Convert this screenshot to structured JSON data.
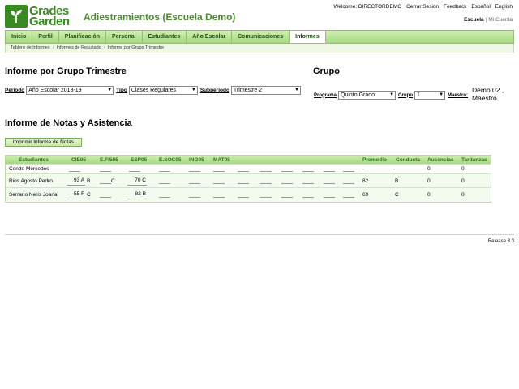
{
  "app": {
    "logo_line1": "Grades",
    "logo_line2": "Garden",
    "title": "Adiestramientos (Escuela Demo)"
  },
  "top_links": {
    "welcome": "Welcome: DIRECTORDEMO",
    "logout": "Cerrar Sesión",
    "feedback": "Feedback",
    "lang_es": "Español",
    "lang_en": "English",
    "school": "Escuela",
    "separator": "|",
    "account": "Mi Cuenta"
  },
  "nav": {
    "items": [
      "Inicio",
      "Perfil",
      "Planificación",
      "Personal",
      "Estudiantes",
      "Año Escolar",
      "Comunicaciones",
      "Informes"
    ],
    "active": "Informes"
  },
  "breadcrumb": {
    "items": [
      "Tablero de Informes",
      "Informes de Resultado",
      "Informe por Grupo Trimestre"
    ],
    "arrow": "›"
  },
  "headings": {
    "left": "Informe por Grupo Trimestre",
    "right": "Grupo",
    "report": "Informe de Notas y Asistencia"
  },
  "filters": {
    "periodo_label": "Periodo",
    "periodo_value": "Año Escolar 2018-19",
    "tipo_label": "Tipo",
    "tipo_value": "Clases Regulares",
    "subperiodo_label": "Subperiodo",
    "subperiodo_value": "Trimestre 2",
    "programa_label": "Programa",
    "programa_value": "Quinto Grado",
    "grupo_label": "Grupo",
    "grupo_value": "1",
    "maestro_label": "Maestro:",
    "maestro_value": "Demo 02 , Maestro"
  },
  "print_button": "Imprimir Informe de Notas",
  "grid": {
    "headers": {
      "students": "Estudiantes",
      "subjects": [
        "CIE05",
        "E.FI505",
        "ESP05",
        "E.SOC05",
        "ING05",
        "MAT05"
      ],
      "promedio": "Promedio",
      "conducta": "Conducta",
      "ausencias": "Ausencias",
      "tardanzas": "Tardanzas"
    },
    "rows": [
      {
        "name": "Conde Mercedes",
        "cie": "",
        "cie_c": "",
        "efi": "",
        "efi_c": "",
        "esp": "",
        "promedio": "-",
        "conducta": "-",
        "ausencias": "0",
        "tardanzas": "0"
      },
      {
        "name": "Rios Agosto Pedro",
        "cie": "93 A",
        "cie_c": "B",
        "efi": "",
        "efi_c": "C",
        "esp": "70 C",
        "promedio": "82",
        "conducta": "B",
        "ausencias": "0",
        "tardanzas": "0"
      },
      {
        "name": "Serrano Neris Joana",
        "cie": "55 F",
        "cie_c": "C",
        "efi": "",
        "efi_c": "",
        "esp": "82 B",
        "promedio": "69",
        "conducta": "C",
        "ausencias": "0",
        "tardanzas": "0"
      }
    ]
  },
  "footer": {
    "release": "Release 3.3"
  },
  "colors": {
    "brand_green": "#3a8a22",
    "nav_green": "#a6d880"
  }
}
